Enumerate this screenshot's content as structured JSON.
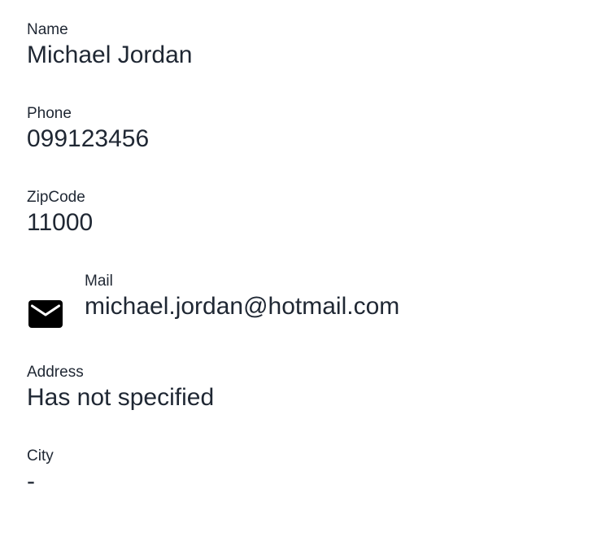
{
  "contact": {
    "name": {
      "label": "Name",
      "value": "Michael Jordan"
    },
    "phone": {
      "label": "Phone",
      "value": "099123456"
    },
    "zipcode": {
      "label": "ZipCode",
      "value": "11000"
    },
    "mail": {
      "label": "Mail",
      "value": "michael.jordan@hotmail.com",
      "icon": "mail-icon"
    },
    "address": {
      "label": "Address",
      "value": "Has not specified"
    },
    "city": {
      "label": "City",
      "value": "-"
    }
  }
}
